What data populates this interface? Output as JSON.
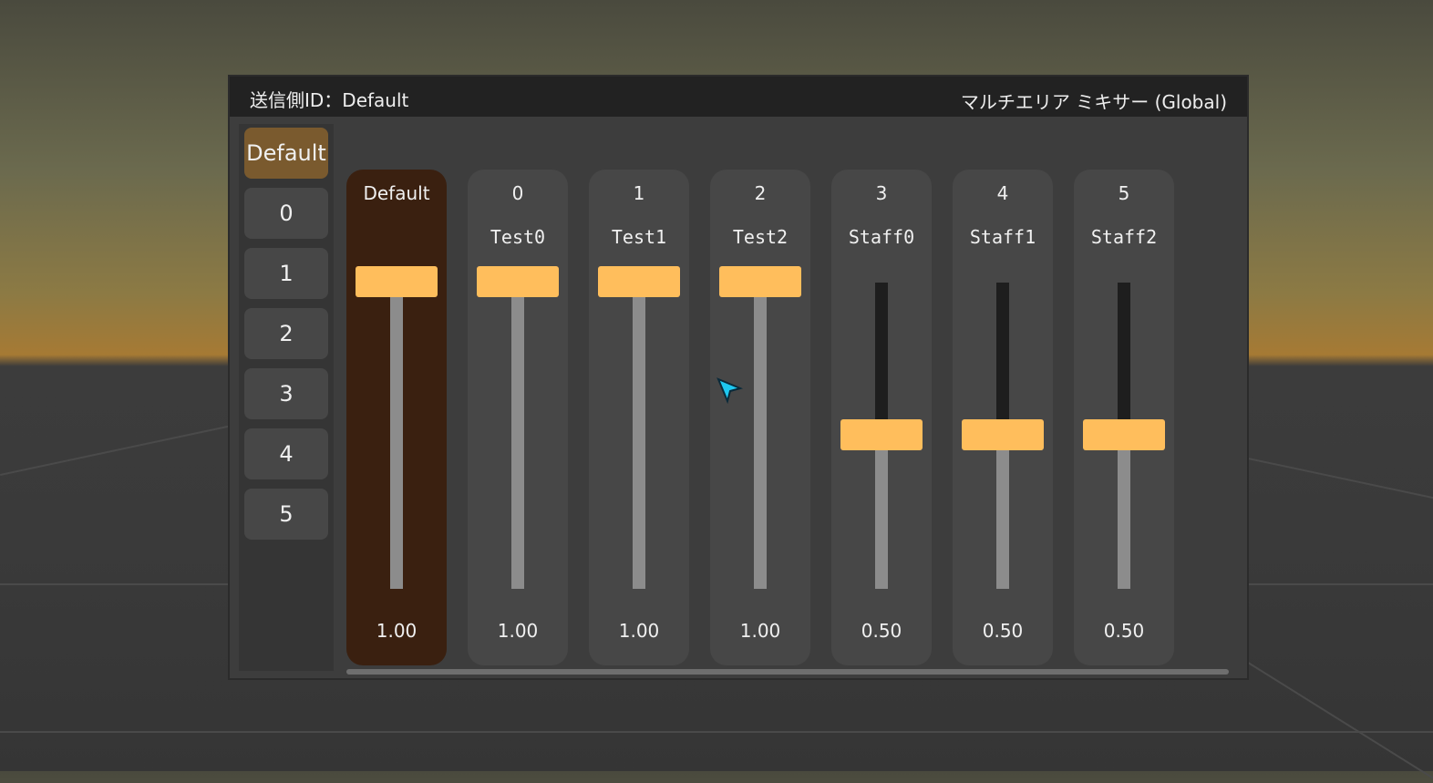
{
  "header": {
    "sender_id": "送信側ID：Default",
    "title": "マルチエリア ミキサー (Global)"
  },
  "tabs": [
    {
      "label": "Default",
      "active": true
    },
    {
      "label": "0",
      "active": false
    },
    {
      "label": "1",
      "active": false
    },
    {
      "label": "2",
      "active": false
    },
    {
      "label": "3",
      "active": false
    },
    {
      "label": "4",
      "active": false
    },
    {
      "label": "5",
      "active": false
    }
  ],
  "channels": [
    {
      "number": "Default",
      "name": "",
      "value": "1.00",
      "level": 1.0,
      "active": true
    },
    {
      "number": "0",
      "name": "Test0",
      "value": "1.00",
      "level": 1.0,
      "active": false
    },
    {
      "number": "1",
      "name": "Test1",
      "value": "1.00",
      "level": 1.0,
      "active": false
    },
    {
      "number": "2",
      "name": "Test2",
      "value": "1.00",
      "level": 1.0,
      "active": false
    },
    {
      "number": "3",
      "name": "Staff0",
      "value": "0.50",
      "level": 0.5,
      "active": false
    },
    {
      "number": "4",
      "name": "Staff1",
      "value": "0.50",
      "level": 0.5,
      "active": false
    },
    {
      "number": "5",
      "name": "Staff2",
      "value": "0.50",
      "level": 0.5,
      "active": false
    }
  ],
  "colors": {
    "knob": "#ffbe5c",
    "active_tab": "#7a5a2e",
    "active_channel": "#3a2010",
    "cursor": "#1ec8f0"
  },
  "cursor_icon": "pointer-arrow-icon"
}
